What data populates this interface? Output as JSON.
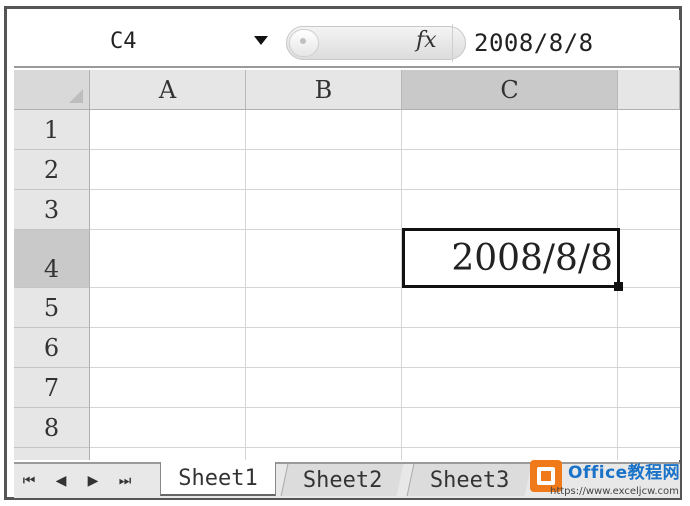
{
  "formula_bar": {
    "name_box": "C4",
    "formula_value": "2008/8/8",
    "fx_label": "fx"
  },
  "grid": {
    "columns": [
      {
        "label": "A"
      },
      {
        "label": "B"
      },
      {
        "label": "C"
      }
    ],
    "rows": [
      {
        "label": "1"
      },
      {
        "label": "2"
      },
      {
        "label": "3"
      },
      {
        "label": "4"
      },
      {
        "label": "5"
      },
      {
        "label": "6"
      },
      {
        "label": "7"
      },
      {
        "label": "8"
      }
    ],
    "active_cell": {
      "ref": "C4",
      "value": "2008/8/8"
    }
  },
  "sheet_tabs": [
    {
      "label": "Sheet1",
      "active": true
    },
    {
      "label": "Sheet2",
      "active": false
    },
    {
      "label": "Sheet3",
      "active": false
    }
  ],
  "tab_nav": {
    "first": "⏮",
    "prev": "◀",
    "next": "▶",
    "last": "⏭"
  },
  "watermark": {
    "title": "Office教程网",
    "url": "https://www.exceljcw.com"
  },
  "colors": {
    "active_border": "#111111",
    "header_bg": "#e6e6e6",
    "active_header_bg": "#c9c9c9",
    "watermark_orange": "#f07a1a",
    "watermark_blue": "#1a73c8"
  }
}
